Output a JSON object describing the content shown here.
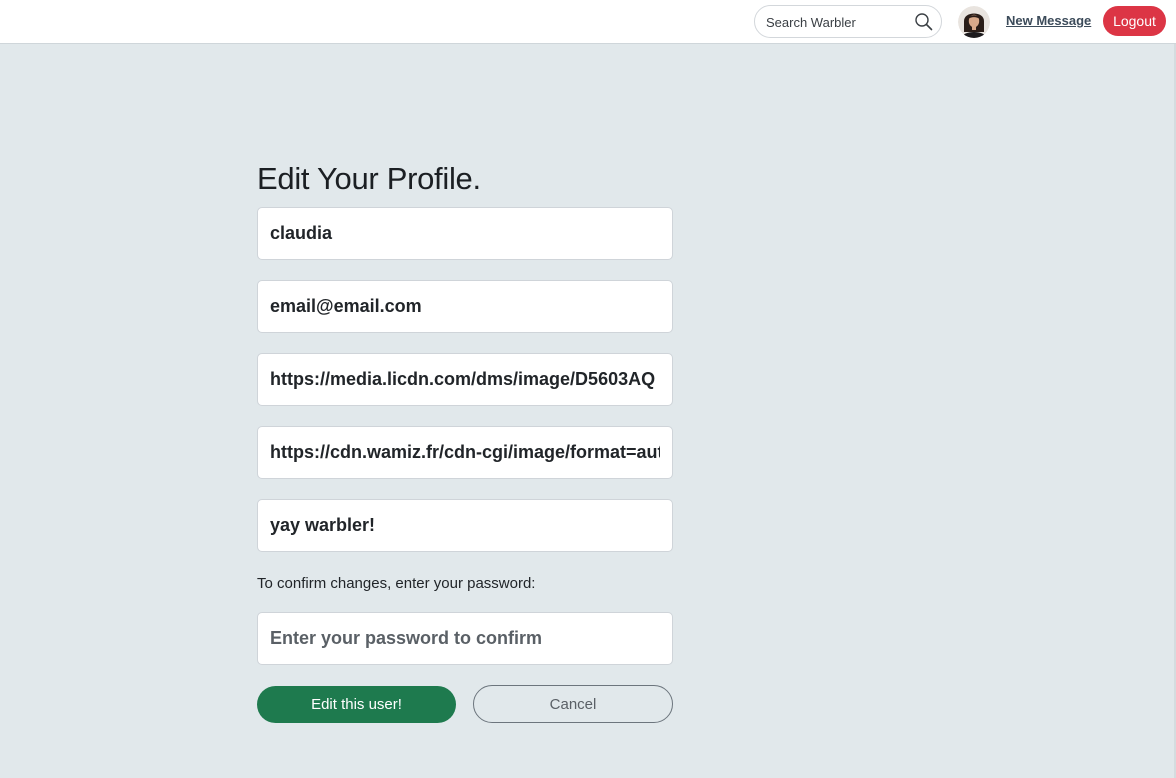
{
  "navbar": {
    "search": {
      "placeholder": "Search Warbler",
      "icon": "search-icon"
    },
    "avatar": {
      "icon": "user-avatar"
    },
    "new_message_label": "New Message",
    "logout_label": "Logout",
    "logout_color": "#dc3545"
  },
  "form": {
    "title": "Edit Your Profile.",
    "fields": {
      "username": "claudia",
      "email": "email@email.com",
      "image_url": "https://media.licdn.com/dms/image/D5603AQ",
      "header_image_url": "https://cdn.wamiz.fr/cdn-cgi/image/format=auto",
      "bio": "yay warbler!"
    },
    "confirm_label": "To confirm changes, enter your password:",
    "password_placeholder": "Enter your password to confirm",
    "submit_label": "Edit this user!",
    "submit_color": "#1e7a4e",
    "cancel_label": "Cancel"
  }
}
